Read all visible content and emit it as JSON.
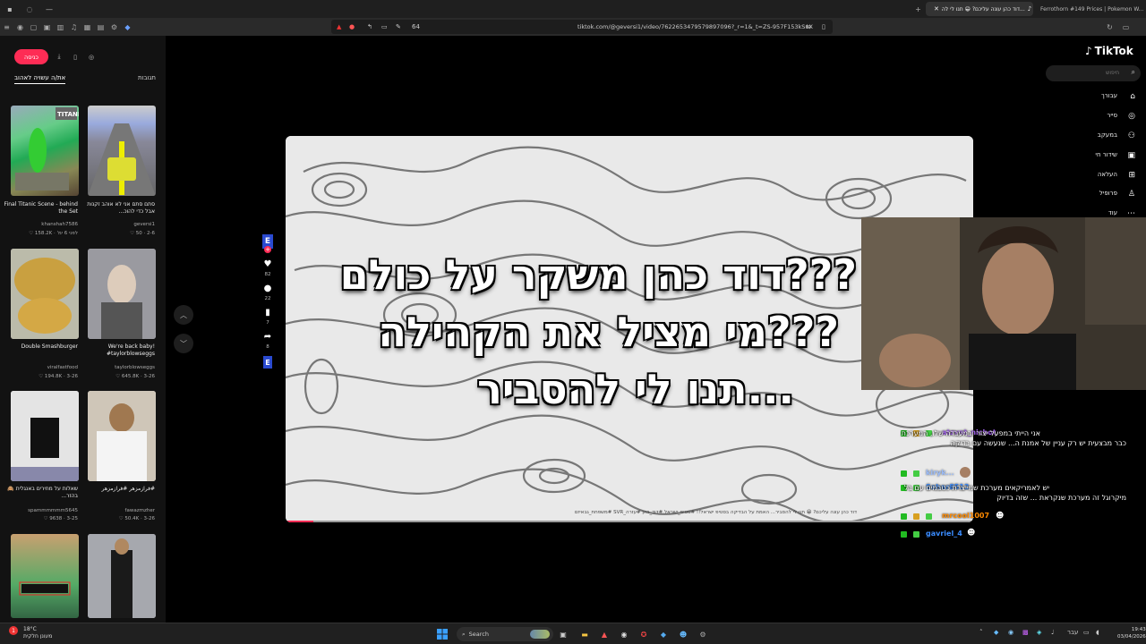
{
  "browser": {
    "tabs": [
      {
        "title": "דוד כהן עונה עליכם? 😁 תנו לי לה...",
        "active": true
      },
      {
        "title": "Ferrothorn #149 Prices | Pokemon W...",
        "active": false
      }
    ],
    "url": "tiktok.com/@geversi1/video/7622653479579897096?_r=1&_t=ZS-957F153kSuX",
    "extensions_count": "64"
  },
  "tiktok": {
    "logo": "TikTok",
    "search_placeholder": "חיפוש",
    "nav": [
      {
        "label": "עבורך",
        "icon": "home-icon"
      },
      {
        "label": "סייר",
        "icon": "compass-icon"
      },
      {
        "label": "במעקב",
        "icon": "following-icon"
      },
      {
        "label": "שידור חי",
        "icon": "live-icon"
      },
      {
        "label": "העלאה",
        "icon": "upload-icon"
      },
      {
        "label": "פרופיל",
        "icon": "profile-icon"
      },
      {
        "label": "עוד",
        "icon": "more-icon"
      }
    ],
    "login_label": "כניסה",
    "panel_tabs": {
      "you_may_like": "את/ה עשויה לאהוב",
      "comments": "תגובות"
    },
    "recommendations": [
      {
        "caption": "Final Titanic Scene - behind the Set",
        "author": "khanshah7586",
        "date": "לפני 6 ימ'",
        "views": "158.2K"
      },
      {
        "caption": "סתם סתם אני לא אוהב זקנות אבל כדי להוכ...",
        "author": "geversi1",
        "date": "2-6",
        "views": "50"
      },
      {
        "caption": "Double Smashburger",
        "author": "viralfastfood",
        "date": "3-26",
        "views": "194.8K"
      },
      {
        "caption": "We're back baby! #taylorblowseggs",
        "author": "taylorblowseggs",
        "date": "3-26",
        "views": "645.8K"
      },
      {
        "caption": "שאלות על מחירים באנגלית 🙈 בהזר...",
        "author": "spammmmmm5645",
        "date": "3-25",
        "views": "9638"
      },
      {
        "caption": "#فرازمزهر #فرازمزهر",
        "author": "fawazmzher",
        "date": "3-26",
        "views": "50.4K"
      }
    ],
    "actions": [
      {
        "icon": "heart-icon",
        "count": "82"
      },
      {
        "icon": "comment-icon",
        "count": "22"
      },
      {
        "icon": "bookmark-icon",
        "count": "7"
      },
      {
        "icon": "share-icon",
        "count": "8"
      }
    ],
    "video": {
      "overlay_lines": [
        "???דוד כהן משקר על כולם",
        "???מי מציל את הקהילה",
        "...תנו לי להסביר"
      ],
      "caption": "דוד כהן עונה עליכם? 😁 תנו לי להסביר... האמת על הבדיקה בסטיפ ישראל!! #סטיפ_ישראל #דוד_כהן #עזרה_SVR #משפחת_גבאיזם",
      "progress": 0.04
    }
  },
  "chat": [
    {
      "user": "atzvat_nichot",
      "color": "#b06bff",
      "text": "אני הייתי במפעל יצור ובמעבדה שלו, המערכת כבר מבצעית יש רק עניין של אמנת ה... שנעשה עם בדיקה"
    },
    {
      "user": "kiryk...",
      "color": "#7aa8ff",
      "text": ""
    },
    {
      "user": "Sahar8512",
      "color": "#3a8cff",
      "text": "יש לאמריקאים מערכת שמייצרת כטבמים עם בל מיקרוגל זה מערכת שנקראת ... שזה בדיוק"
    },
    {
      "user": "mrcool1007",
      "color": "#ff8a00",
      "text": ""
    },
    {
      "user": "gavriel_4",
      "color": "#3a8cff",
      "text": ""
    }
  ],
  "taskbar": {
    "weather_temp": "18°C",
    "weather_desc": "מעונן חלקית",
    "search_label": "Search",
    "time": "19:43",
    "date": "03/04/2026",
    "lang": "עבר"
  },
  "colors": {
    "accent": "#fe2c55",
    "background": "#000000",
    "chrome": "#2a2a2a"
  }
}
